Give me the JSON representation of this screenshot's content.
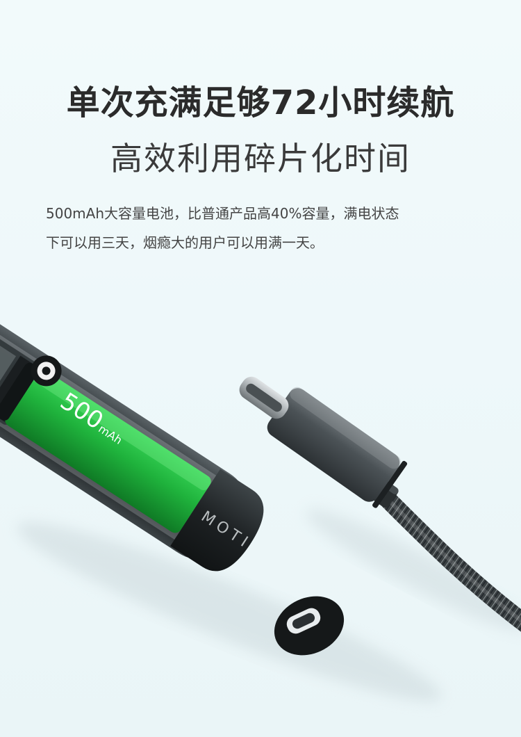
{
  "headline": "单次充满足够72小时续航",
  "subheadline": "高效利用碎片化时间",
  "description": {
    "line1": "500mAh大容量电池，比普通产品高40%容量，满电状态",
    "line2": "下可以用三天，烟瘾大的用户可以用满一天。"
  },
  "product": {
    "battery_capacity": "500",
    "battery_unit": "mAh",
    "brand": "MOTI",
    "battery_color": "#1fb23c",
    "body_color": "#1e2224"
  }
}
